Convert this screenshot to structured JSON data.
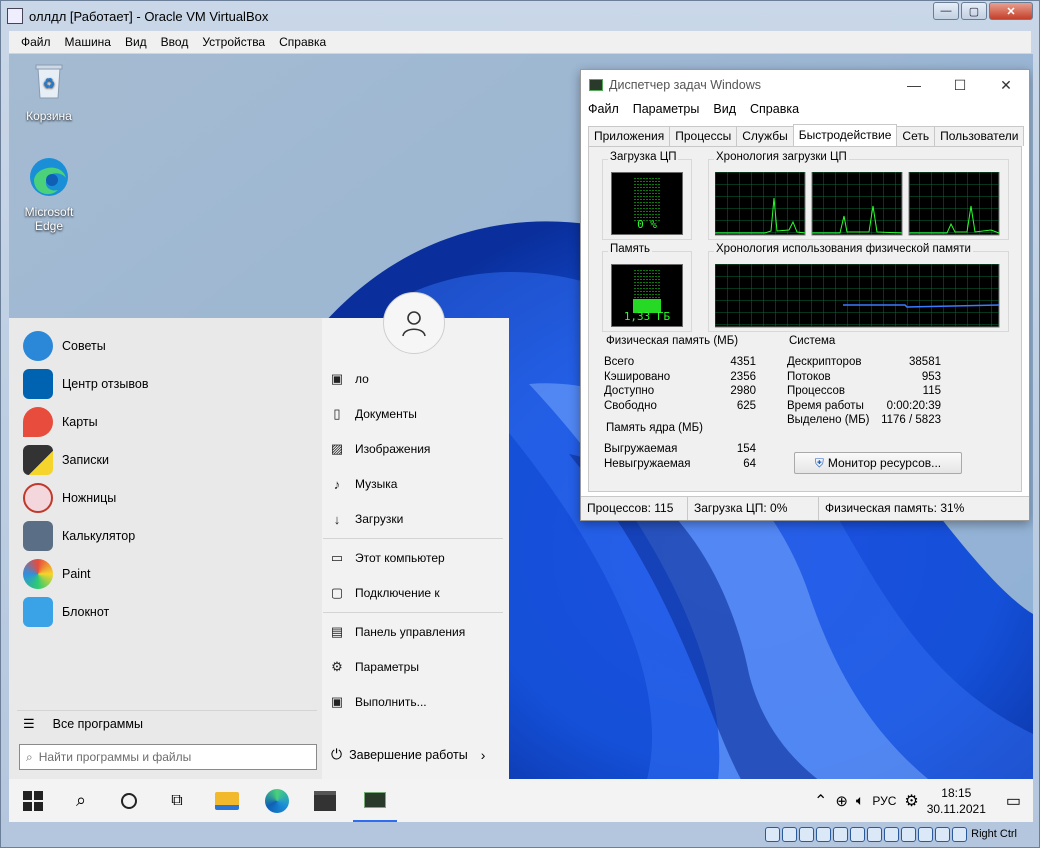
{
  "vbox": {
    "title": "оллдл [Работает] - Oracle VM VirtualBox",
    "menu": [
      "Файл",
      "Машина",
      "Вид",
      "Ввод",
      "Устройства",
      "Справка"
    ],
    "host_key": "Right Ctrl"
  },
  "desktop": {
    "icons": [
      {
        "label": "Корзина",
        "icon": "recycle-bin-icon"
      },
      {
        "label": "Microsoft Edge",
        "icon": "edge-icon"
      }
    ]
  },
  "start_menu": {
    "apps": [
      {
        "label": "Советы",
        "icon": "tips-icon",
        "color": "#2b88d8"
      },
      {
        "label": "Центр отзывов",
        "icon": "feedback-hub-icon",
        "color": "#0063b1"
      },
      {
        "label": "Карты",
        "icon": "maps-icon",
        "color": "#e74c3c"
      },
      {
        "label": "Записки",
        "icon": "sticky-notes-icon",
        "color": "#f5d52c"
      },
      {
        "label": "Ножницы",
        "icon": "snipping-tool-icon",
        "color": "#c0392b"
      },
      {
        "label": "Калькулятор",
        "icon": "calculator-icon",
        "color": "#5a6e85"
      },
      {
        "label": "Paint",
        "icon": "paint-icon",
        "color": "#2f8fe0"
      },
      {
        "label": "Блокнот",
        "icon": "notepad-icon",
        "color": "#3aa3e8"
      }
    ],
    "places": [
      {
        "label": "ло",
        "icon": "user-folder-icon"
      },
      {
        "label": "Документы",
        "icon": "documents-icon"
      },
      {
        "label": "Изображения",
        "icon": "pictures-icon"
      },
      {
        "label": "Музыка",
        "icon": "music-icon"
      },
      {
        "label": "Загрузки",
        "icon": "downloads-icon"
      },
      {
        "label": "Этот компьютер",
        "icon": "computer-icon"
      },
      {
        "label": "Подключение к",
        "icon": "connect-icon"
      },
      {
        "label": "Панель управления",
        "icon": "control-panel-icon"
      },
      {
        "label": "Параметры",
        "icon": "settings-icon"
      },
      {
        "label": "Выполнить...",
        "icon": "run-icon"
      }
    ],
    "all_programs": "Все программы",
    "search_placeholder": "Найти программы и файлы",
    "shutdown": "Завершение работы"
  },
  "taskbar": {
    "lang": "РУС",
    "time": "18:15",
    "date": "30.11.2021"
  },
  "taskmgr": {
    "title": "Диспетчер задач Windows",
    "menu": [
      "Файл",
      "Параметры",
      "Вид",
      "Справка"
    ],
    "tabs": [
      "Приложения",
      "Процессы",
      "Службы",
      "Быстродействие",
      "Сеть",
      "Пользователи"
    ],
    "active_tab": "Быстродействие",
    "cpu_label": "Загрузка ЦП",
    "cpu_value": "0 %",
    "cpu_history_label": "Хронология загрузки ЦП",
    "mem_label": "Память",
    "mem_value": "1,33 ГБ",
    "mem_history_label": "Хронология использования физической памяти",
    "phys_mem": {
      "title": "Физическая память (МБ)",
      "rows": [
        {
          "k": "Всего",
          "v": "4351"
        },
        {
          "k": "Кэшировано",
          "v": "2356"
        },
        {
          "k": "Доступно",
          "v": "2980"
        },
        {
          "k": "Свободно",
          "v": "625"
        }
      ]
    },
    "kernel_mem": {
      "title": "Память ядра (МБ)",
      "rows": [
        {
          "k": "Выгружаемая",
          "v": "154"
        },
        {
          "k": "Невыгружаемая",
          "v": "64"
        }
      ]
    },
    "system": {
      "title": "Система",
      "rows": [
        {
          "k": "Дескрипторов",
          "v": "38581"
        },
        {
          "k": "Потоков",
          "v": "953"
        },
        {
          "k": "Процессов",
          "v": "115"
        },
        {
          "k": "Время работы",
          "v": "0:00:20:39"
        },
        {
          "k": "Выделено (МБ)",
          "v": "1176 / 5823"
        }
      ]
    },
    "resource_monitor_button": "Монитор ресурсов...",
    "status": {
      "processes": "Процессов: 115",
      "cpu": "Загрузка ЦП: 0%",
      "memory": "Физическая память: 31%"
    }
  }
}
